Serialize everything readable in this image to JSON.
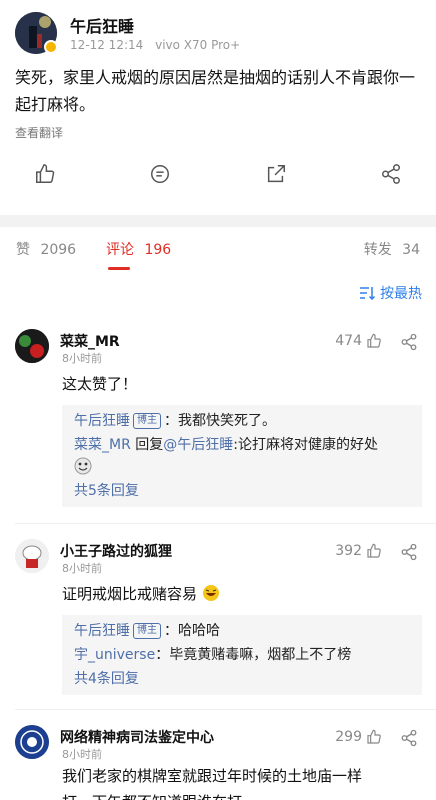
{
  "post": {
    "author": "午后狂睡",
    "time": "12-12 12:14",
    "device": "vivo X70 Pro+",
    "text": "笑死，家里人戒烟的原因居然是抽烟的话别人不肯跟你一起打麻将。",
    "translate": "查看翻译"
  },
  "stats": {
    "likes_label": "赞",
    "likes": "2096",
    "comments_label": "评论",
    "comments": "196",
    "reposts_label": "转发",
    "reposts": "34"
  },
  "sort": {
    "label": "按最热"
  },
  "comments": [
    {
      "name": "菜菜_MR",
      "time": "8小时前",
      "likes": "474",
      "text": "这太赞了！",
      "replies": [
        {
          "name": "午后狂睡",
          "tag": "博主",
          "text": "：我都快笑死了。"
        },
        {
          "name": "菜菜_MR",
          "text": " 回复",
          "mention": "@午后狂睡",
          "text2": ":论打麻将对健康的好处"
        }
      ],
      "more": "共5条回复"
    },
    {
      "name": "小王子路过的狐狸",
      "time": "8小时前",
      "likes": "392",
      "text": "证明戒烟比戒赌容易",
      "replies": [
        {
          "name": "午后狂睡",
          "tag": "博主",
          "text": "：哈哈哈"
        },
        {
          "name": "宇_universe",
          "text": "：毕竟黄赌毒嘛，烟都上不了榜"
        }
      ],
      "more": "共4条回复"
    },
    {
      "name": "网络精神病司法鉴定中心",
      "time": "8小时前",
      "likes": "299",
      "text_line1": "我们老家的棋牌室就跟过年时候的土地庙一样",
      "text_line2": "打一下午都不知道跟谁在打"
    }
  ]
}
